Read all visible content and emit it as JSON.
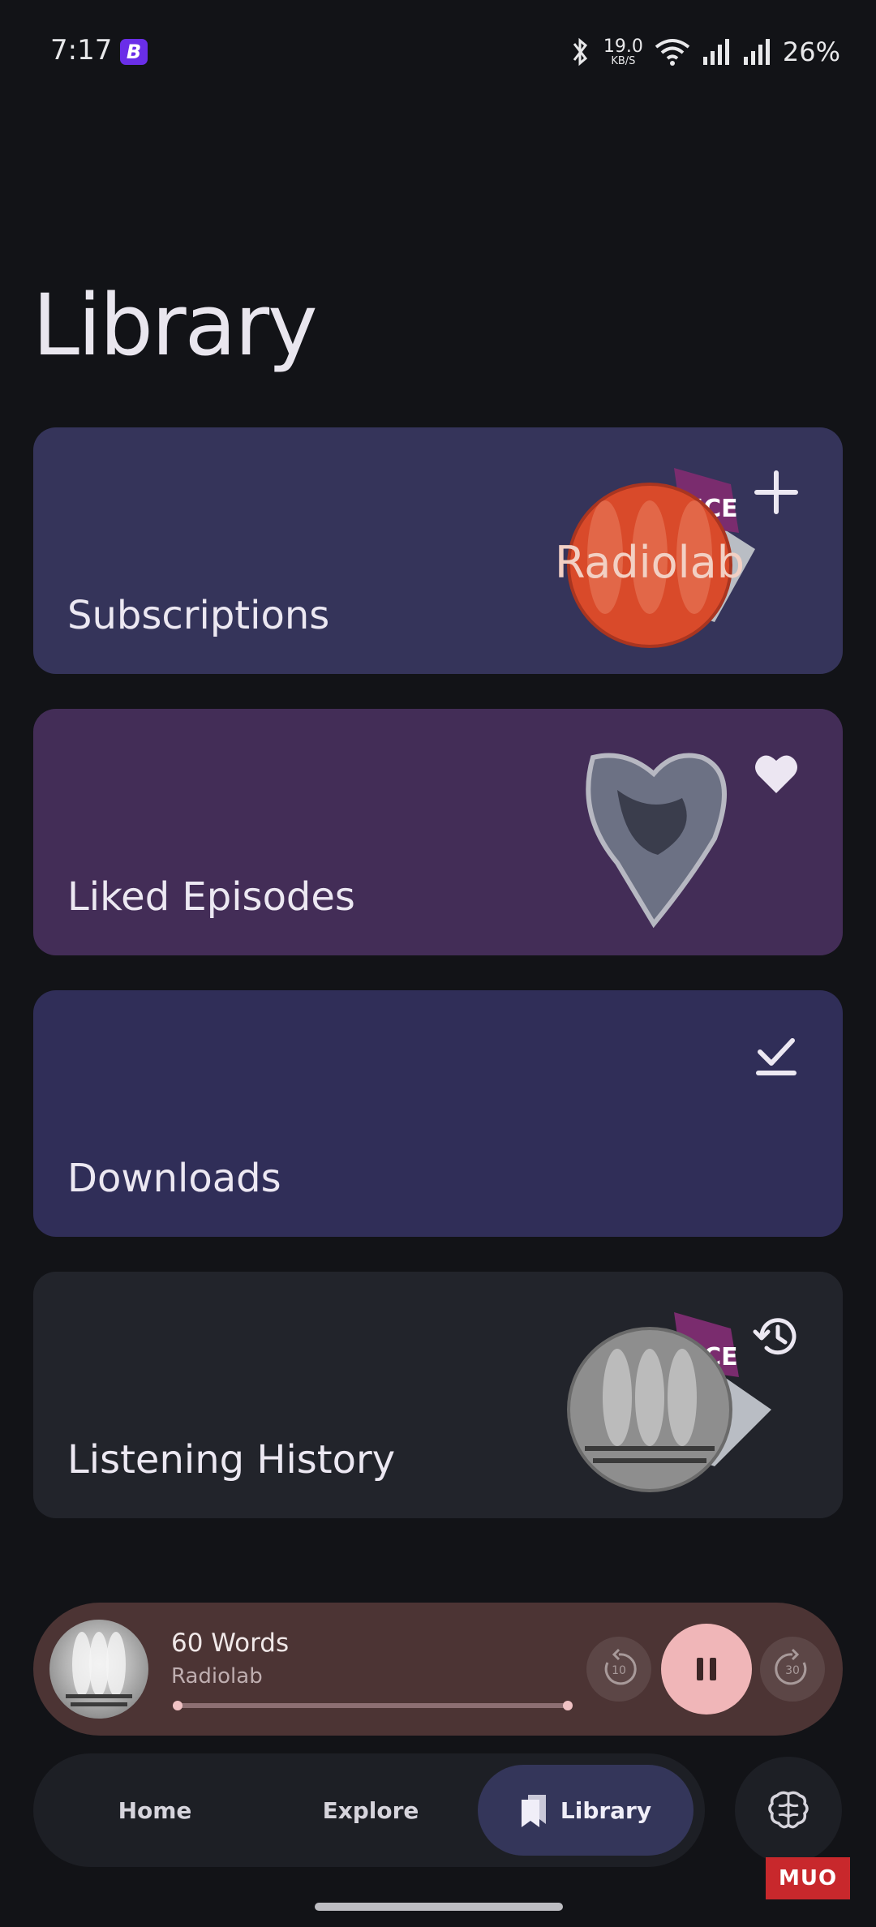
{
  "status_bar": {
    "time": "7:17",
    "app_badge": "B",
    "net_speed": "19.0",
    "net_speed_unit": "KB/S",
    "battery": "26%"
  },
  "page": {
    "title": "Library"
  },
  "cards": {
    "subscriptions": {
      "label": "Subscriptions",
      "icon": "plus-icon",
      "art_text": "Radiolab"
    },
    "liked": {
      "label": "Liked Episodes",
      "icon": "heart-icon"
    },
    "downloads": {
      "label": "Downloads",
      "icon": "download-done-icon"
    },
    "history": {
      "label": "Listening History",
      "icon": "history-icon"
    }
  },
  "player": {
    "title": "60 Words",
    "subtitle": "Radiolab",
    "skip_back_seconds": "10",
    "skip_forward_seconds": "30",
    "progress": 0.99,
    "state": "playing"
  },
  "nav": {
    "home": "Home",
    "explore": "Explore",
    "library": "Library",
    "active": "library"
  },
  "watermark": "MUO",
  "colors": {
    "background": "#121317",
    "subscriptions_card": "#35345a",
    "liked_card": "#432d57",
    "downloads_card": "#302e58",
    "history_card": "#22242b",
    "player_bg": "#4c3434",
    "play_button": "#f0b6b8",
    "nav_active": "#34365a"
  }
}
